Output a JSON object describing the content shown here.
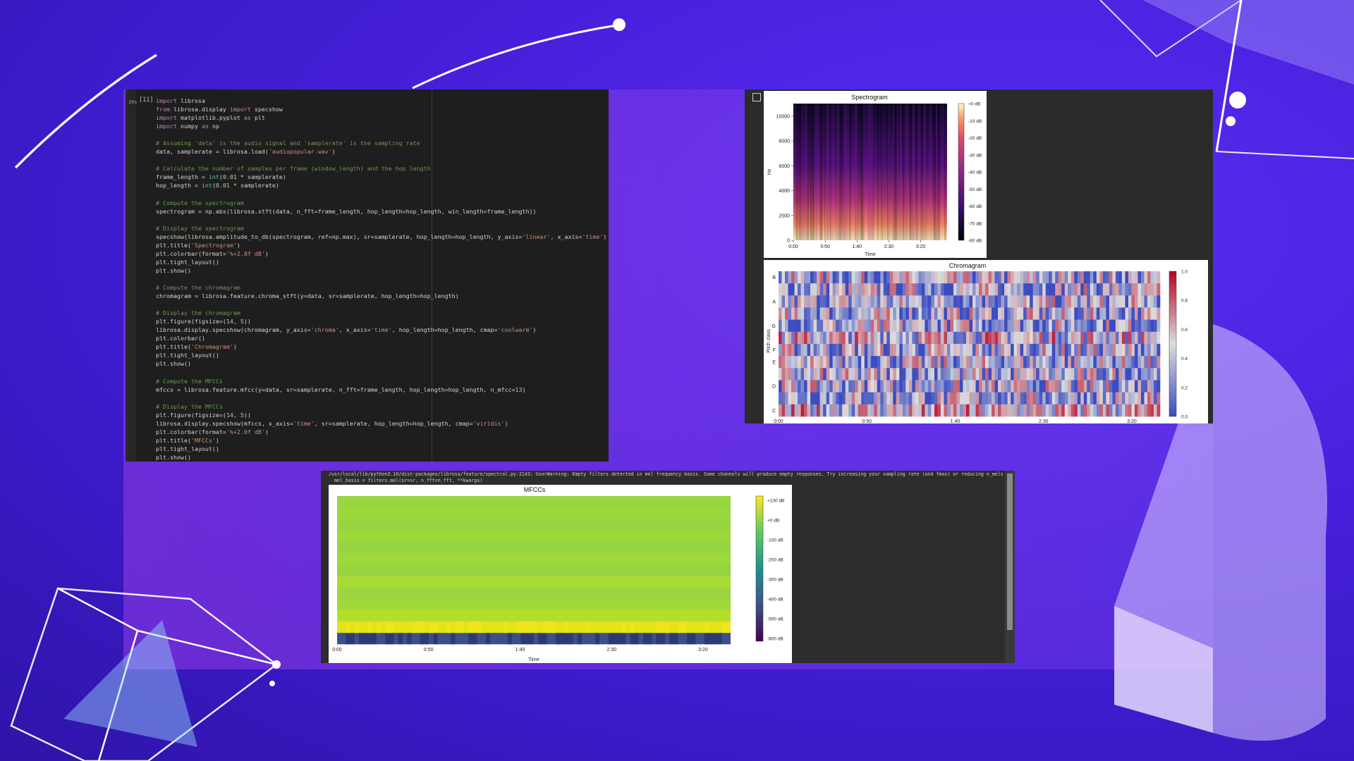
{
  "notebook": {
    "cell_number": "[11]",
    "run_time": "30s",
    "code_lines": [
      [
        [
          "kw",
          "import"
        ],
        [
          "t",
          " librosa"
        ]
      ],
      [
        [
          "kw",
          "from"
        ],
        [
          "t",
          " librosa.display "
        ],
        [
          "kw",
          "import"
        ],
        [
          "t",
          " specshow"
        ]
      ],
      [
        [
          "kw",
          "import"
        ],
        [
          "t",
          " matplotlib.pyplot "
        ],
        [
          "kw",
          "as"
        ],
        [
          "t",
          " plt"
        ]
      ],
      [
        [
          "kw",
          "import"
        ],
        [
          "t",
          " numpy "
        ],
        [
          "kw",
          "as"
        ],
        [
          "t",
          " np"
        ]
      ],
      [],
      [
        [
          "cm",
          "# Assuming 'data' is the audio signal and 'samplerate' is the sampling rate"
        ]
      ],
      [
        [
          "t",
          "data, samplerate = librosa.load("
        ],
        [
          "st",
          "'audiopopular.wav'"
        ],
        [
          "t",
          ")"
        ]
      ],
      [],
      [
        [
          "cm",
          "# Calculate the number of samples per frame (window_length) and the hop length"
        ]
      ],
      [
        [
          "t",
          "frame_length = "
        ],
        [
          "bi",
          "int"
        ],
        [
          "t",
          "("
        ],
        [
          "nm",
          "0.01"
        ],
        [
          "t",
          " * samplerate)"
        ]
      ],
      [
        [
          "t",
          "hop_length = "
        ],
        [
          "bi",
          "int"
        ],
        [
          "t",
          "("
        ],
        [
          "nm",
          "0.01"
        ],
        [
          "t",
          " * samplerate)"
        ]
      ],
      [],
      [
        [
          "cm",
          "# Compute the spectrogram"
        ]
      ],
      [
        [
          "t",
          "spectrogram = np.abs(librosa.stft(data, n_fft=frame_length, hop_length=hop_length, win_length=frame_length))"
        ]
      ],
      [],
      [
        [
          "cm",
          "# Display the spectrogram"
        ]
      ],
      [
        [
          "t",
          "specshow(librosa.amplitude_to_db(spectrogram, ref=np.max), sr=samplerate, hop_length=hop_length, y_axis="
        ],
        [
          "st",
          "'linear'"
        ],
        [
          "t",
          ", x_axis="
        ],
        [
          "st",
          "'time'"
        ],
        [
          "t",
          ")"
        ]
      ],
      [
        [
          "t",
          "plt.title("
        ],
        [
          "st",
          "'Spectrogram'"
        ],
        [
          "t",
          ")"
        ]
      ],
      [
        [
          "t",
          "plt.colorbar(format="
        ],
        [
          "st",
          "'%+2.0f dB'"
        ],
        [
          "t",
          ")"
        ]
      ],
      [
        [
          "t",
          "plt.tight_layout()"
        ]
      ],
      [
        [
          "t",
          "plt.show()"
        ]
      ],
      [],
      [
        [
          "cm",
          "# Compute the chromagram"
        ]
      ],
      [
        [
          "t",
          "chromagram = librosa.feature.chroma_stft(y=data, sr=samplerate, hop_length=hop_length)"
        ]
      ],
      [],
      [
        [
          "cm",
          "# Display the chromagram"
        ]
      ],
      [
        [
          "t",
          "plt.figure(figsize=("
        ],
        [
          "nm",
          "14"
        ],
        [
          "t",
          ", "
        ],
        [
          "nm",
          "5"
        ],
        [
          "t",
          "))"
        ]
      ],
      [
        [
          "t",
          "librosa.display.specshow(chromagram, y_axis="
        ],
        [
          "st",
          "'chroma'"
        ],
        [
          "t",
          ", x_axis="
        ],
        [
          "st",
          "'time'"
        ],
        [
          "t",
          ", hop_length=hop_length, cmap="
        ],
        [
          "st",
          "'coolwarm'"
        ],
        [
          "t",
          ")"
        ]
      ],
      [
        [
          "t",
          "plt.colorbar()"
        ]
      ],
      [
        [
          "t",
          "plt.title("
        ],
        [
          "st",
          "'Chromagram'"
        ],
        [
          "t",
          ")"
        ]
      ],
      [
        [
          "t",
          "plt.tight_layout()"
        ]
      ],
      [
        [
          "t",
          "plt.show()"
        ]
      ],
      [],
      [
        [
          "cm",
          "# Compute the MFCCs"
        ]
      ],
      [
        [
          "t",
          "mfccs = librosa.feature.mfcc(y=data, sr=samplerate, n_fft=frame_length, hop_length=hop_length, n_mfcc="
        ],
        [
          "nm",
          "13"
        ],
        [
          "t",
          ")"
        ]
      ],
      [],
      [
        [
          "cm",
          "# Display the MFCCs"
        ]
      ],
      [
        [
          "t",
          "plt.figure(figsize=("
        ],
        [
          "nm",
          "14"
        ],
        [
          "t",
          ", "
        ],
        [
          "nm",
          "5"
        ],
        [
          "t",
          "))"
        ]
      ],
      [
        [
          "t",
          "librosa.display.specshow(mfccs, x_axis="
        ],
        [
          "st",
          "'time'"
        ],
        [
          "t",
          ", sr=samplerate, hop_length=hop_length, cmap="
        ],
        [
          "st",
          "'viridis'"
        ],
        [
          "t",
          ")"
        ]
      ],
      [
        [
          "t",
          "plt.colorbar(format="
        ],
        [
          "st",
          "'%+2.0f dB'"
        ],
        [
          "t",
          ")"
        ]
      ],
      [
        [
          "t",
          "plt.title("
        ],
        [
          "st",
          "'MFCCs'"
        ],
        [
          "t",
          ")"
        ]
      ],
      [
        [
          "t",
          "plt.tight_layout()"
        ]
      ],
      [
        [
          "t",
          "plt.show()"
        ]
      ]
    ]
  },
  "warning_text": "/usr/local/lib/python3.10/dist-packages/librosa/feature/spectral.py:2143: UserWarning: Empty filters detected in mel frequency basis. Some channels will produce empty responses. Try increasing your sampling rate (and fmax) or reducing n_mels\n  mel_basis = filters.mel(sr=sr, n_fft=n_fft, **kwargs)",
  "chart_data": [
    {
      "type": "heatmap",
      "title": "Spectrogram",
      "xlabel": "Time",
      "ylabel": "Hz",
      "x_ticks": [
        "0:00",
        "0:50",
        "1:40",
        "2:30",
        "3:20"
      ],
      "y_ticks": [
        "0",
        "2000",
        "4000",
        "6000",
        "8000",
        "10000"
      ],
      "ylim": [
        0,
        11025
      ],
      "colorbar_ticks": [
        "+0 dB",
        "-10 dB",
        "-20 dB",
        "-30 dB",
        "-40 dB",
        "-50 dB",
        "-60 dB",
        "-70 dB",
        "-80 dB"
      ],
      "colormap": "magma"
    },
    {
      "type": "heatmap",
      "title": "Chromagram",
      "xlabel": "",
      "ylabel": "Pitch class",
      "x_ticks": [
        "0:00",
        "0:50",
        "1:40",
        "2:30",
        "3:20"
      ],
      "y_ticks": [
        "C",
        "D",
        "E",
        "F",
        "G",
        "A",
        "B"
      ],
      "colorbar_ticks": [
        "0.0",
        "0.2",
        "0.4",
        "0.6",
        "0.8",
        "1.0"
      ],
      "colormap": "coolwarm"
    },
    {
      "type": "heatmap",
      "title": "MFCCs",
      "xlabel": "Time",
      "ylabel": "",
      "x_ticks": [
        "0:00",
        "0:50",
        "1:40",
        "2:30",
        "3:20"
      ],
      "colorbar_ticks": [
        "+100 dB",
        "+0 dB",
        "-100 dB",
        "-200 dB",
        "-300 dB",
        "-400 dB",
        "-500 dB",
        "-600 dB"
      ],
      "colormap": "viridis"
    }
  ],
  "colors": {
    "background": "#4a22e0",
    "code_bg": "#1e1e1e",
    "output_bg": "#2b2b2b"
  }
}
